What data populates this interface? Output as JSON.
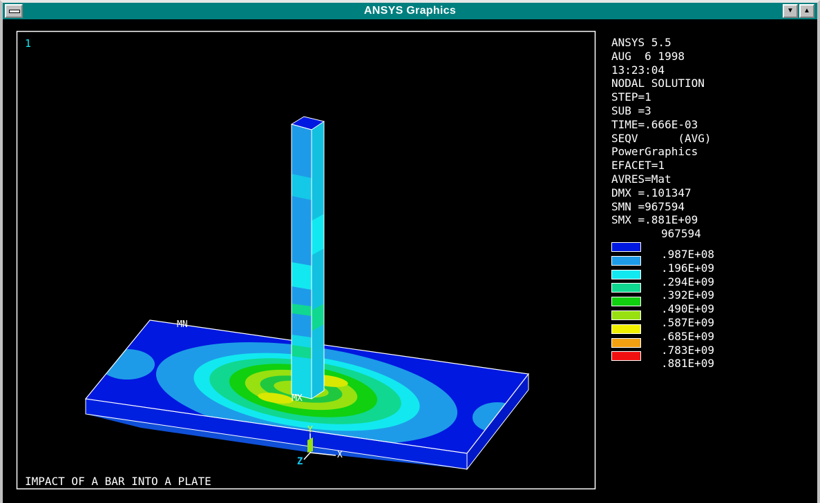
{
  "window": {
    "title": "ANSYS Graphics",
    "minimize_glyph": "▼",
    "maximize_glyph": "▲",
    "system_menu_icon": "system-menu-icon"
  },
  "viewport": {
    "window_number": "1",
    "caption": "IMPACT OF A BAR INTO A PLATE",
    "min_label": "MN",
    "max_label": "MX",
    "triad": {
      "x": "X",
      "y": "Y",
      "z": "Z"
    }
  },
  "info": [
    "ANSYS 5.5",
    "AUG  6 1998",
    "13:23:04",
    "NODAL SOLUTION",
    "STEP=1",
    "SUB =3",
    "TIME=.666E-03",
    "SEQV      (AVG)",
    "PowerGraphics",
    "EFACET=1",
    "AVRES=Mat",
    "DMX =.101347",
    "SMN =967594",
    "SMX =.881E+09"
  ],
  "legend": {
    "min_value": "967594",
    "bands": [
      {
        "color": "#0018e0",
        "value": ".987E+08"
      },
      {
        "color": "#1e9be8",
        "value": ".196E+09"
      },
      {
        "color": "#12e8f0",
        "value": ".294E+09"
      },
      {
        "color": "#10d890",
        "value": ".392E+09"
      },
      {
        "color": "#10d010",
        "value": ".490E+09"
      },
      {
        "color": "#98e010",
        "value": ".587E+09"
      },
      {
        "color": "#f0f000",
        "value": ".685E+09"
      },
      {
        "color": "#f0a010",
        "value": ".783E+09"
      },
      {
        "color": "#f01010",
        "value": ".881E+09"
      }
    ]
  }
}
